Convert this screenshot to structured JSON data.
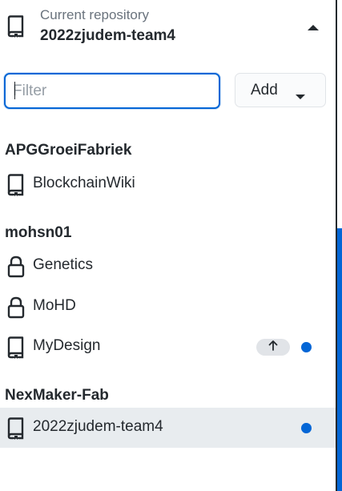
{
  "header": {
    "label": "Current repository",
    "repo_name": "2022zjudem-team4"
  },
  "filter": {
    "placeholder": "Filter",
    "value": ""
  },
  "add_button": {
    "label": "Add"
  },
  "colors": {
    "accent": "#0366d6",
    "selected_bg": "#e8ecef",
    "text": "#24292e",
    "muted": "#6a737d"
  },
  "groups": [
    {
      "title": "APGGroeiFabriek",
      "repos": [
        {
          "name": "BlockchainWiki",
          "icon": "repo-icon",
          "ahead": false,
          "changes": false,
          "selected": false
        }
      ]
    },
    {
      "title": "mohsn01",
      "repos": [
        {
          "name": "Genetics",
          "icon": "lock-icon",
          "ahead": false,
          "changes": false,
          "selected": false
        },
        {
          "name": "MoHD",
          "icon": "lock-icon",
          "ahead": false,
          "changes": false,
          "selected": false
        },
        {
          "name": "MyDesign",
          "icon": "repo-icon",
          "ahead": true,
          "changes": true,
          "selected": false
        }
      ]
    },
    {
      "title": "NexMaker-Fab",
      "repos": [
        {
          "name": "2022zjudem-team4",
          "icon": "repo-icon",
          "ahead": false,
          "changes": true,
          "selected": true
        }
      ]
    }
  ]
}
